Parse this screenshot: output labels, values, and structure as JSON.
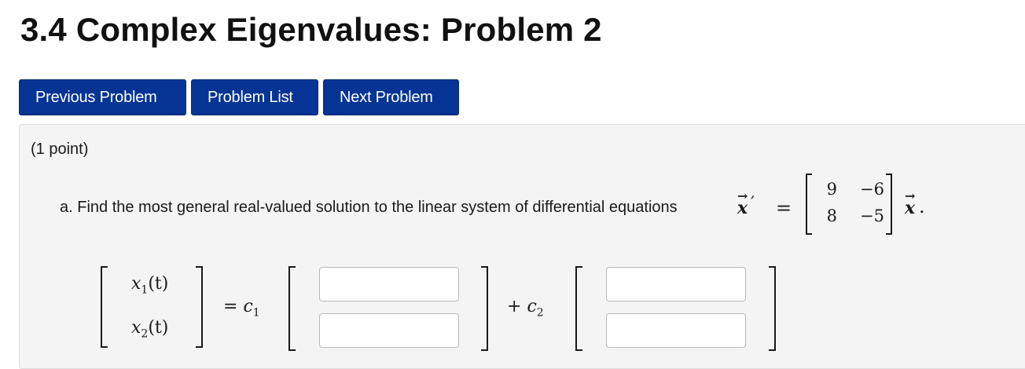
{
  "page": {
    "title": "3.4 Complex Eigenvalues: Problem 2"
  },
  "nav": {
    "previous_label": "Previous Problem",
    "list_label": "Problem List",
    "next_label": "Next Problem",
    "button_color": "#063494"
  },
  "problem": {
    "points": "(1 point)",
    "question_text": "a. Find the most general real-valued solution to the linear system of differential equations",
    "vector_symbol": "x",
    "prime": "′",
    "equals": "=",
    "period": ".",
    "matrix": [
      [
        "9",
        "−6"
      ],
      [
        "8",
        "−5"
      ]
    ]
  },
  "solution": {
    "lhs": [
      "x",
      "x"
    ],
    "lhs_subs": [
      "1",
      "2"
    ],
    "lhs_arg": "(t)",
    "equals": "=",
    "c1": "c",
    "c1_sub": "1",
    "plus": "+",
    "c2": "c",
    "c2_sub": "2",
    "inputs": {
      "v1_top": "",
      "v1_bottom": "",
      "v2_top": "",
      "v2_bottom": ""
    }
  }
}
